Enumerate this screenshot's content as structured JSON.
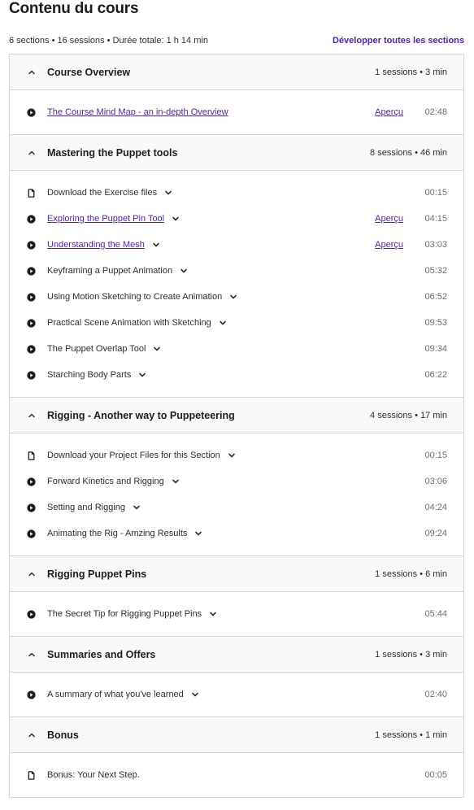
{
  "header": {
    "title": "Contenu du cours",
    "summary": "6 sections • 16 sessions • Durée totale: 1 h 14 min",
    "expand_all": "Développer toutes les sections"
  },
  "colors": {
    "accent": "#5022c3",
    "header_bg": "#f7f9fa",
    "border": "#d1d7dc"
  },
  "sections": [
    {
      "title": "Course Overview",
      "meta": "1 sessions • 3 min",
      "lectures": [
        {
          "icon": "play-circle-icon",
          "title": "The Course Mind Map - an in-depth Overview",
          "link": true,
          "dropdown": false,
          "preview": "Aperçu",
          "duration": "02:48"
        }
      ]
    },
    {
      "title": "Mastering the Puppet tools",
      "meta": "8 sessions • 46 min",
      "lectures": [
        {
          "icon": "file-icon",
          "title": "Download the Exercise files",
          "link": false,
          "dropdown": true,
          "preview": null,
          "duration": "00:15"
        },
        {
          "icon": "play-circle-icon",
          "title": "Exploring the Puppet Pin Tool",
          "link": true,
          "dropdown": true,
          "preview": "Aperçu",
          "duration": "04:15"
        },
        {
          "icon": "play-circle-icon",
          "title": "Understanding the Mesh",
          "link": true,
          "dropdown": true,
          "preview": "Aperçu",
          "duration": "03:03"
        },
        {
          "icon": "play-circle-icon",
          "title": "Keyframing a Puppet Animation",
          "link": false,
          "dropdown": true,
          "preview": null,
          "duration": "05:32"
        },
        {
          "icon": "play-circle-icon",
          "title": "Using Motion Sketching to Create Animation",
          "link": false,
          "dropdown": true,
          "preview": null,
          "duration": "06:52"
        },
        {
          "icon": "play-circle-icon",
          "title": "Practical Scene Animation with Sketching",
          "link": false,
          "dropdown": true,
          "preview": null,
          "duration": "09:53"
        },
        {
          "icon": "play-circle-icon",
          "title": "The Puppet Overlap Tool",
          "link": false,
          "dropdown": true,
          "preview": null,
          "duration": "09:34"
        },
        {
          "icon": "play-circle-icon",
          "title": "Starching Body Parts",
          "link": false,
          "dropdown": true,
          "preview": null,
          "duration": "06:22"
        }
      ]
    },
    {
      "title": "Rigging - Another way to Puppeteering",
      "meta": "4 sessions • 17 min",
      "lectures": [
        {
          "icon": "file-icon",
          "title": "Download your Project Files for this Section",
          "link": false,
          "dropdown": true,
          "preview": null,
          "duration": "00:15"
        },
        {
          "icon": "play-circle-icon",
          "title": "Forward Kinetics and Rigging",
          "link": false,
          "dropdown": true,
          "preview": null,
          "duration": "03:06"
        },
        {
          "icon": "play-circle-icon",
          "title": "Setting and Rigging",
          "link": false,
          "dropdown": true,
          "preview": null,
          "duration": "04:24"
        },
        {
          "icon": "play-circle-icon",
          "title": "Animating the Rig - Amzing Results",
          "link": false,
          "dropdown": true,
          "preview": null,
          "duration": "09:24"
        }
      ]
    },
    {
      "title": "Rigging Puppet Pins",
      "meta": "1 sessions • 6 min",
      "lectures": [
        {
          "icon": "play-circle-icon",
          "title": "The Secret Tip for Rigging Puppet Pins",
          "link": false,
          "dropdown": true,
          "preview": null,
          "duration": "05:44"
        }
      ]
    },
    {
      "title": "Summaries and Offers",
      "meta": "1 sessions • 3 min",
      "lectures": [
        {
          "icon": "play-circle-icon",
          "title": "A summary of what you've learned",
          "link": false,
          "dropdown": true,
          "preview": null,
          "duration": "02:40"
        }
      ]
    },
    {
      "title": "Bonus",
      "meta": "1 sessions • 1 min",
      "lectures": [
        {
          "icon": "file-icon",
          "title": "Bonus: Your Next Step.",
          "link": false,
          "dropdown": false,
          "preview": null,
          "duration": "00:05"
        }
      ]
    }
  ]
}
